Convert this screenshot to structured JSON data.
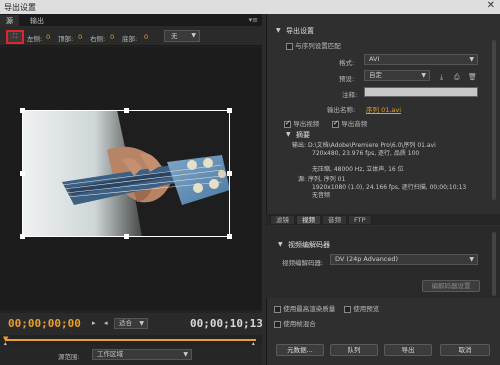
{
  "window": {
    "title": "导出设置",
    "close": "✕"
  },
  "left_tabs": {
    "source": "源",
    "output": "输出"
  },
  "crop_toolbar": {
    "crop_icon": "crop-icon",
    "left_label": "左侧:",
    "left_value": "0",
    "top_label": "顶部:",
    "top_value": "0",
    "right_label": "右侧:",
    "right_value": "0",
    "bottom_label": "底部:",
    "bottom_value": "0",
    "ratio": "无"
  },
  "timeline": {
    "in_timecode": "00;00;00;00",
    "out_timecode": "00;00;10;13",
    "fit": "适合"
  },
  "source_range": {
    "label": "源范围:",
    "value": "工作区域"
  },
  "export_settings": {
    "header": "导出设置",
    "match_sequence": "与序列设置匹配",
    "format_label": "格式:",
    "format": "AVI",
    "preset_label": "预设:",
    "preset": "自定",
    "comment_label": "注释:",
    "output_name_label": "输出名称:",
    "output_name": "序列 01.avi",
    "export_video": "导出视频",
    "export_audio": "导出音频"
  },
  "summary": {
    "header": "摘要",
    "output_label": "输出:",
    "output_path": "D:\\文档\\Adobe\\Premiere Pro\\6.0\\序列 01.avi",
    "output_line2": "720x480, 23.976 fps, 逐行, 品质 100",
    "output_line3": "无压缩, 48000 Hz, 立体声, 16 位",
    "source_label": "源:",
    "source_line1": "序列, 序列 01",
    "source_line2": "1920x1080 (1.0), 24.166 fps, 逐行扫描, 00;00;10;13",
    "source_line3": "无音频"
  },
  "right_tabs": [
    "滤镜",
    "视频",
    "音频",
    "FTP"
  ],
  "video_codec": {
    "header": "视频编解码器",
    "codec_label": "视频编解码器:",
    "codec": "DV (24p Advanced)",
    "settings_button": "编解码器设置"
  },
  "bottom_options": {
    "max_render": "使用最高渲染质量",
    "use_preview": "使用预览",
    "use_frame_blend": "使用帧混合"
  },
  "actions": {
    "metadata": "元数据...",
    "queue": "队列",
    "export": "导出",
    "cancel": "取消"
  }
}
